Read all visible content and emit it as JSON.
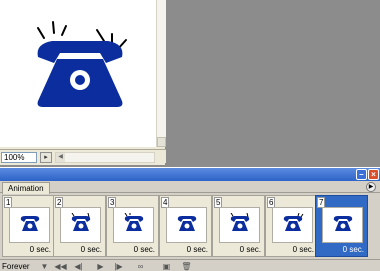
{
  "document": {
    "zoom": "100%"
  },
  "panel": {
    "tab_label": "Animation",
    "loop_option": "Forever",
    "frames": [
      {
        "number": "1",
        "delay": "0 sec."
      },
      {
        "number": "2",
        "delay": "0 sec."
      },
      {
        "number": "3",
        "delay": "0 sec."
      },
      {
        "number": "4",
        "delay": "0 sec."
      },
      {
        "number": "5",
        "delay": "0 sec."
      },
      {
        "number": "6",
        "delay": "0 sec."
      },
      {
        "number": "7",
        "delay": "0 sec."
      }
    ],
    "selected_frame": "7"
  },
  "colors": {
    "phone": "#0b2d9e",
    "selection": "#316ac5"
  },
  "icons": [
    "telephone-icon",
    "ring-lines-icon",
    "first-frame-icon",
    "previous-frame-icon",
    "play-icon",
    "next-frame-icon",
    "tween-icon",
    "new-frame-icon",
    "delete-frame-icon"
  ]
}
